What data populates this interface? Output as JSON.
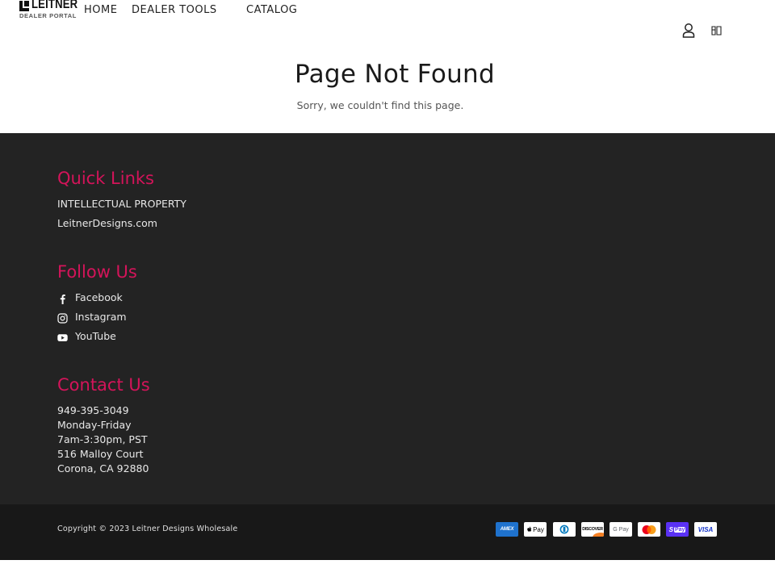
{
  "header": {
    "logo": {
      "word": "LEITNER",
      "sub": "DEALER PORTAL"
    },
    "nav": [
      {
        "label": "HOME"
      },
      {
        "label": "DEALER TOOLS"
      },
      {
        "label": "CATALOG"
      }
    ],
    "icons": [
      "account-icon",
      "cart-icon"
    ]
  },
  "main": {
    "title": "Page Not Found",
    "subtitle": "Sorry, we couldn't find this page."
  },
  "footer": {
    "quick_links": {
      "heading": "Quick Links",
      "items": [
        "INTELLECTUAL PROPERTY",
        "LeitnerDesigns.com"
      ]
    },
    "follow": {
      "heading": "Follow Us",
      "items": [
        {
          "label": "Facebook",
          "icon": "facebook-icon"
        },
        {
          "label": "Instagram",
          "icon": "instagram-icon"
        },
        {
          "label": "YouTube",
          "icon": "youtube-icon"
        }
      ]
    },
    "contact": {
      "heading": "Contact Us",
      "lines": [
        "949-395-3049",
        "Monday-Friday",
        "7am-3:30pm, PST",
        "516 Malloy Court",
        "Corona, CA 92880"
      ]
    },
    "accent_color": "#d4145a",
    "background_color": "#232323"
  },
  "bottom": {
    "copyright": "Copyright © 2023 Leitner Designs Wholesale",
    "payments": [
      {
        "name": "American Express",
        "icon": "amex-icon",
        "text": "AMEX"
      },
      {
        "name": "Apple Pay",
        "icon": "apple-pay-icon",
        "text": "Pay"
      },
      {
        "name": "Diners Club",
        "icon": "diners-club-icon"
      },
      {
        "name": "Discover",
        "icon": "discover-icon",
        "text": "DISCOVER"
      },
      {
        "name": "Google Pay",
        "icon": "google-pay-icon",
        "text": "G Pay"
      },
      {
        "name": "Mastercard",
        "icon": "mastercard-icon"
      },
      {
        "name": "Shop Pay",
        "icon": "shop-pay-icon",
        "text": "Pay"
      },
      {
        "name": "Visa",
        "icon": "visa-icon",
        "text": "VISA"
      }
    ]
  }
}
